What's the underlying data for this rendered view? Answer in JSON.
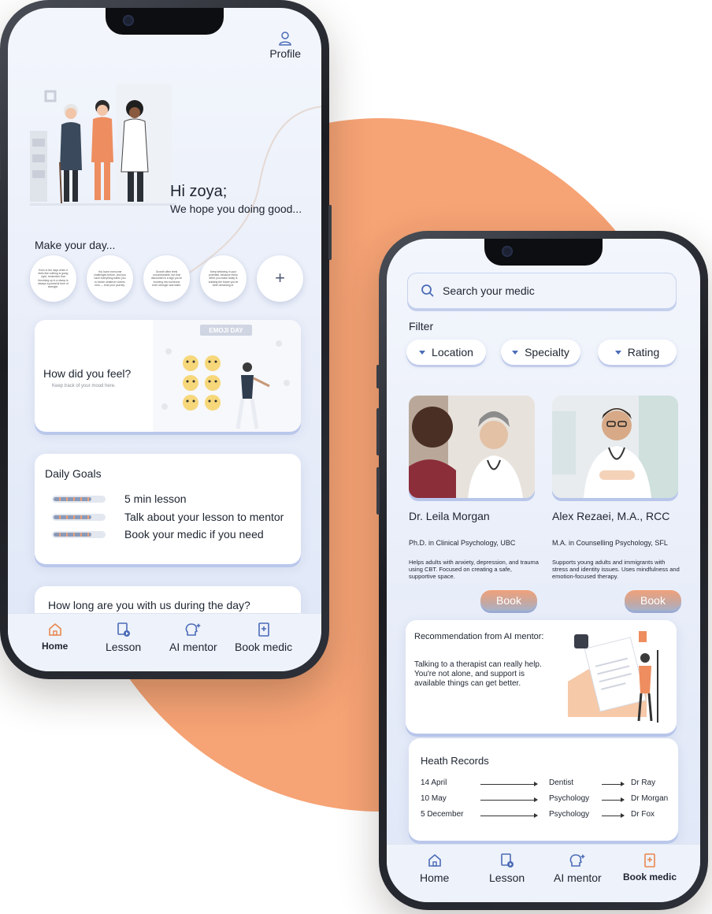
{
  "phone1": {
    "profile_label": "Profile",
    "greeting": "Hi zoya;",
    "greeting_sub": "We hope you doing good...",
    "make_day_title": "Make your day...",
    "quotes": [
      "Even in the days when it feels like nothing is going right, remember that blooming up in a slump is always a powerful form of strength.",
      "You have overcome challenges before, and you have everything within you to bloom whatever comes next — trust your journey.",
      "Growth often feels uncomfortable, but that discomfort is a sign you're evolving into someone even stronger and wiser.",
      "Keep believing in your potential, because every effort you make today is building the future you've been dreaming of."
    ],
    "add_quote_label": "+",
    "mood_card": {
      "question": "How did you feel?",
      "hint": "Keep track of your mood here.",
      "art_banner": "EMOJI DAY"
    },
    "daily_goals": {
      "title": "Daily Goals",
      "items": [
        {
          "label": "5 min lesson",
          "progress": 0.7
        },
        {
          "label": "Talk about your lesson to mentor",
          "progress": 0.7
        },
        {
          "label": "Book your medic if you need",
          "progress": 0.7
        }
      ]
    },
    "time_card_title": "How long are you with us during the day?",
    "tabs": [
      {
        "label": "Home",
        "icon": "home-icon",
        "active": true
      },
      {
        "label": "Lesson",
        "icon": "lesson-icon",
        "active": false
      },
      {
        "label": "AI mentor",
        "icon": "ai-mentor-icon",
        "active": false
      },
      {
        "label": "Book medic",
        "icon": "book-medic-icon",
        "active": false
      }
    ]
  },
  "phone2": {
    "search_placeholder": "Search your medic",
    "filter_label": "Filter",
    "filters": [
      "Location",
      "Specialty",
      "Rating"
    ],
    "medics": [
      {
        "name": "Dr. Leila Morgan",
        "credential": "Ph.D. in Clinical Psychology, UBC",
        "description": "Helps adults with anxiety, depression, and trauma using CBT. Focused on creating a safe, supportive space.",
        "book_label": "Book"
      },
      {
        "name": "Alex Rezaei, M.A., RCC",
        "credential": "M.A. in Counselling Psychology, SFL",
        "description": "Supports young adults and immigrants with stress and identity issues. Uses mindfulness and emotion-focused therapy.",
        "book_label": "Book"
      }
    ],
    "recommendation": {
      "title": "Recommendation from AI mentor:",
      "body": "Talking to a therapist can really help. You're not alone, and support is available things can get better."
    },
    "health_records": {
      "title": "Heath Records",
      "rows": [
        {
          "date": "14 April",
          "type": "Dentist",
          "doctor": "Dr Ray"
        },
        {
          "date": "10 May",
          "type": "Psychology",
          "doctor": "Dr Morgan"
        },
        {
          "date": "5 December",
          "type": "Psychology",
          "doctor": "Dr Fox"
        }
      ]
    },
    "tabs": [
      {
        "label": "Home",
        "icon": "home-icon",
        "active": false
      },
      {
        "label": "Lesson",
        "icon": "lesson-icon",
        "active": false
      },
      {
        "label": "AI mentor",
        "icon": "ai-mentor-icon",
        "active": false
      },
      {
        "label": "Book medic",
        "icon": "book-medic-icon",
        "active": true
      }
    ]
  },
  "colors": {
    "accent_orange": "#f59e6e",
    "nav_blue": "#4b6cb7",
    "screen_bg": "#e9eef9",
    "card_shadow": "#b9c7eb"
  }
}
